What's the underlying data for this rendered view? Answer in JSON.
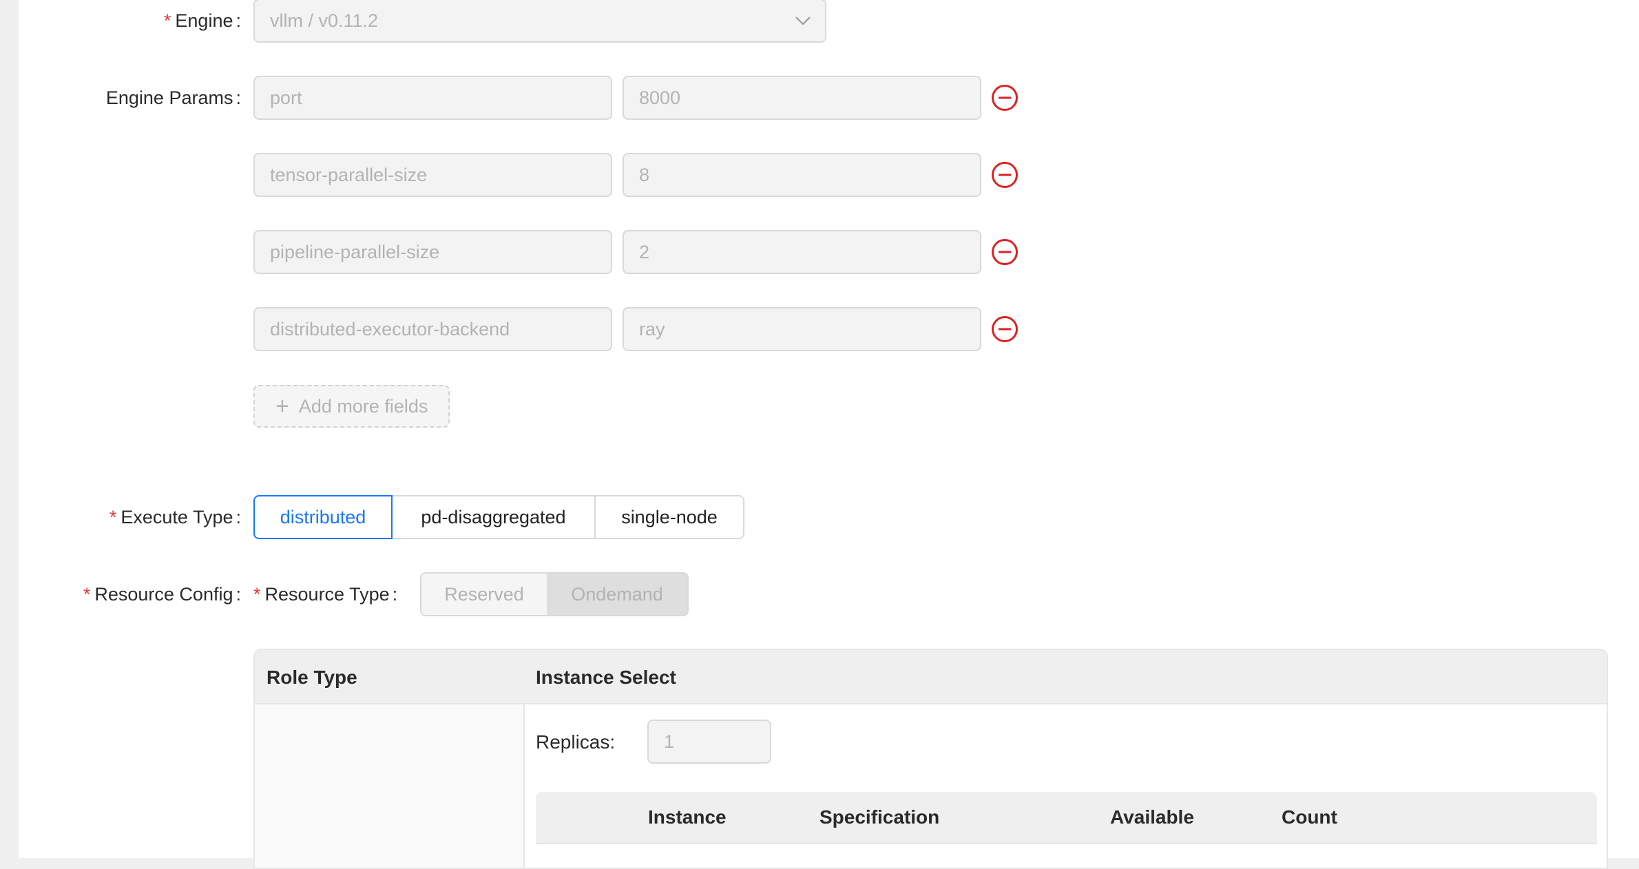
{
  "form": {
    "engine": {
      "label": "Engine",
      "value": "vllm / v0.11.2",
      "required": true,
      "icon": "chevron-down-icon"
    },
    "engine_params": {
      "label": "Engine Params",
      "rows": [
        {
          "key": "port",
          "value": "8000"
        },
        {
          "key": "tensor-parallel-size",
          "value": "8"
        },
        {
          "key": "pipeline-parallel-size",
          "value": "2"
        },
        {
          "key": "distributed-executor-backend",
          "value": "ray"
        }
      ],
      "add_more_label": "Add more fields"
    },
    "execute_type": {
      "label": "Execute Type",
      "required": true,
      "options": [
        "distributed",
        "pd-disaggregated",
        "single-node"
      ],
      "selected": "distributed"
    },
    "resource_config": {
      "label": "Resource Config",
      "required": true,
      "resource_type": {
        "label": "Resource Type",
        "required": true,
        "options": [
          "Reserved",
          "Ondemand"
        ],
        "selected": "Ondemand"
      }
    },
    "table": {
      "headers": [
        "Role Type",
        "Instance Select"
      ],
      "replicas_label": "Replicas:",
      "replicas_value": "1",
      "inner_headers": [
        "Instance",
        "Specification",
        "Available",
        "Count"
      ]
    }
  },
  "colors": {
    "accent": "#1677ff",
    "required": "#e23b3b",
    "remove": "#e02020"
  }
}
